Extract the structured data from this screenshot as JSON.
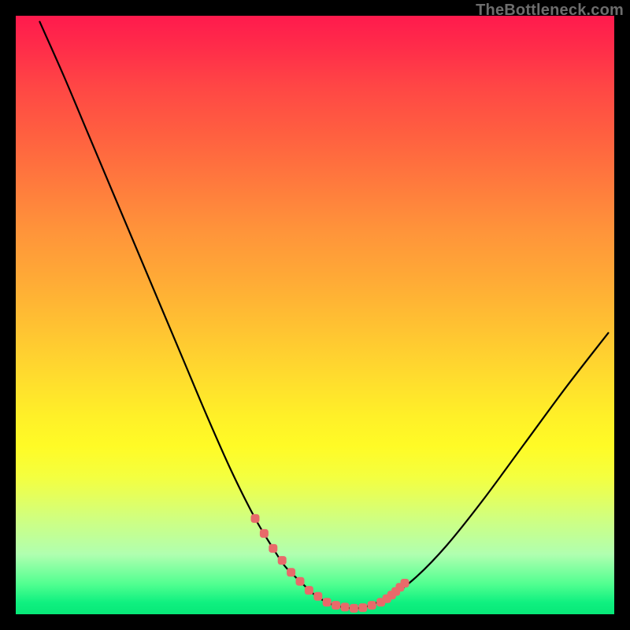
{
  "watermark": "TheBottleneck.com",
  "chart_data": {
    "type": "line",
    "title": "",
    "xlabel": "",
    "ylabel": "",
    "xlim": [
      0,
      100
    ],
    "ylim": [
      0,
      100
    ],
    "grid": false,
    "series": [
      {
        "name": "curve",
        "color": "#000000",
        "x": [
          4,
          8,
          12,
          16,
          20,
          24,
          28,
          32,
          36,
          40,
          43,
          45,
          47.5,
          50,
          52,
          54,
          56,
          58,
          60,
          63,
          67,
          72,
          78,
          85,
          92,
          99
        ],
        "y": [
          99,
          90,
          80.5,
          71,
          61.5,
          52,
          42.5,
          33,
          24,
          16,
          11,
          8,
          5.5,
          3.2,
          2.0,
          1.3,
          1.0,
          1.1,
          1.8,
          3.2,
          6.3,
          11.5,
          19,
          28.5,
          38,
          47
        ]
      },
      {
        "name": "highlight-dots",
        "color": "#e86a6a",
        "x": [
          40,
          41.5,
          43,
          44.5,
          46,
          47.5,
          49,
          50.5,
          52,
          53.5,
          55,
          56.5,
          58,
          59.5,
          61,
          62,
          62.8,
          63.5,
          64.2,
          65
        ],
        "y": [
          16,
          13.5,
          11,
          9,
          7,
          5.5,
          4,
          3,
          2.0,
          1.5,
          1.2,
          1.0,
          1.1,
          1.5,
          2.0,
          2.6,
          3.2,
          3.8,
          4.5,
          5.2
        ]
      }
    ]
  }
}
